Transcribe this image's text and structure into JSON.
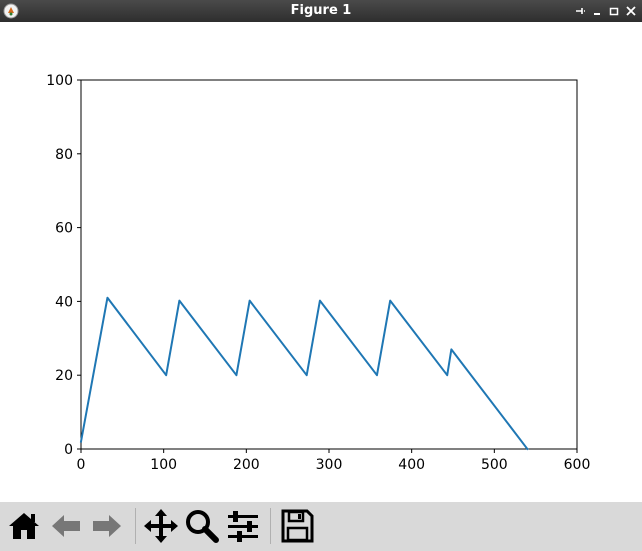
{
  "window": {
    "title": "Figure 1"
  },
  "toolbar": {
    "buttons": [
      {
        "name": "home-button",
        "icon": "home-icon"
      },
      {
        "name": "back-button",
        "icon": "arrow-left-icon"
      },
      {
        "name": "forward-button",
        "icon": "arrow-right-icon"
      },
      {
        "name": "pan-button",
        "icon": "move-icon"
      },
      {
        "name": "zoom-button",
        "icon": "magnifier-icon"
      },
      {
        "name": "configure-subplots-button",
        "icon": "sliders-icon"
      },
      {
        "name": "save-button",
        "icon": "floppy-disk-icon"
      }
    ]
  },
  "colors": {
    "line": "#1f77b4",
    "titlebar": "#3a3a3a",
    "toolbar": "#d9d9d9"
  },
  "chart_data": {
    "type": "line",
    "title": "",
    "xlabel": "",
    "ylabel": "",
    "xlim": [
      0,
      600
    ],
    "ylim": [
      0,
      100
    ],
    "xticks": [
      0,
      100,
      200,
      300,
      400,
      500,
      600
    ],
    "yticks": [
      0,
      20,
      40,
      60,
      80,
      100
    ],
    "xtick_labels": [
      "0",
      "100",
      "200",
      "300",
      "400",
      "500",
      "600"
    ],
    "ytick_labels": [
      "0",
      "20",
      "40",
      "60",
      "80",
      "100"
    ],
    "grid": false,
    "legend": "none",
    "series": [
      {
        "x": [
          0,
          32,
          103,
          119,
          188,
          204,
          273,
          289,
          358,
          374,
          443,
          448,
          540
        ],
        "y": [
          2,
          41,
          20,
          40.2,
          20,
          40.2,
          20,
          40.2,
          20,
          40.2,
          20,
          27,
          0
        ]
      }
    ]
  }
}
